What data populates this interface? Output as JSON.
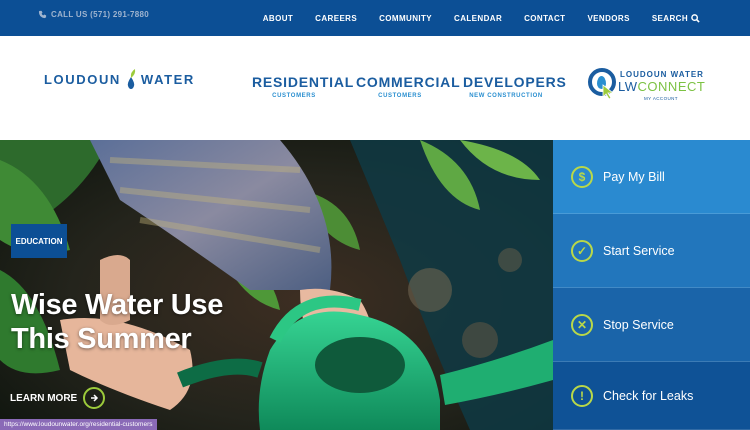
{
  "topbar": {
    "call": "CALL US (571) 291-7880",
    "nav": [
      "ABOUT",
      "CAREERS",
      "COMMUNITY",
      "CALENDAR",
      "CONTACT",
      "VENDORS",
      "SEARCH"
    ]
  },
  "header": {
    "logo_left": "LOUDOUN",
    "logo_right": "WATER",
    "nav": [
      {
        "label": "RESIDENTIAL",
        "sub": "CUSTOMERS"
      },
      {
        "label": "COMMERCIAL",
        "sub": "CUSTOMERS"
      },
      {
        "label": "DEVELOPERS",
        "sub": "NEW CONSTRUCTION"
      }
    ],
    "lwconnect": {
      "line1": "LOUDOUN WATER",
      "lw": "LW",
      "connect": "CONNECT",
      "line3": "MY ACCOUNT"
    }
  },
  "hero": {
    "badge": "EDUCATION",
    "title": "Wise Water Use This Summer",
    "cta": "LEARN MORE"
  },
  "side_actions": [
    {
      "label": "Pay My Bill",
      "icon": "$"
    },
    {
      "label": "Start Service",
      "icon": "✓"
    },
    {
      "label": "Stop Service",
      "icon": "✕"
    },
    {
      "label": "Check for Leaks",
      "icon": "!"
    }
  ],
  "status_url": "https://www.loudounwater.org/residential-customers",
  "colors": {
    "topbar": "#0c4f95",
    "brand_blue": "#1b5da0",
    "accent_green": "#b9d849",
    "link_blue": "#2a8fd0"
  }
}
